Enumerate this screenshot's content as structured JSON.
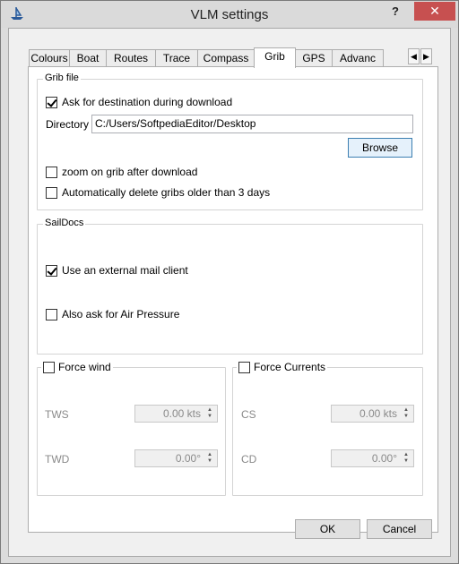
{
  "window": {
    "title": "VLM settings",
    "help": "?",
    "close": "✕"
  },
  "tabs": [
    {
      "label": "Colours"
    },
    {
      "label": "Boat"
    },
    {
      "label": "Routes"
    },
    {
      "label": "Trace"
    },
    {
      "label": "Compass"
    },
    {
      "label": "Grib",
      "active": true
    },
    {
      "label": "GPS"
    },
    {
      "label": "Advanc"
    }
  ],
  "tab_scroll": {
    "left": "◀",
    "right": "▶"
  },
  "grib": {
    "legend": "Grib file",
    "ask_destination": {
      "label": "Ask for destination during download",
      "checked": true
    },
    "directory_label": "Directory",
    "directory_value": "C:/Users/SoftpediaEditor/Desktop",
    "browse": "Browse",
    "zoom": {
      "label": "zoom on grib after download",
      "checked": false
    },
    "auto_delete": {
      "label": "Automatically delete gribs older than 3 days",
      "checked": false
    }
  },
  "saildocs": {
    "legend": "SailDocs",
    "external_mail": {
      "label": "Use an external mail client",
      "checked": true
    },
    "air_pressure": {
      "label": "Also ask for Air Pressure",
      "checked": false
    }
  },
  "force_wind": {
    "legend": "Force wind",
    "checked": false,
    "tws_label": "TWS",
    "tws_value": "0.00 kts",
    "twd_label": "TWD",
    "twd_value": "0.00°"
  },
  "force_currents": {
    "legend": "Force Currents",
    "checked": false,
    "cs_label": "CS",
    "cs_value": "0.00 kts",
    "cd_label": "CD",
    "cd_value": "0.00°"
  },
  "buttons": {
    "ok": "OK",
    "cancel": "Cancel"
  }
}
